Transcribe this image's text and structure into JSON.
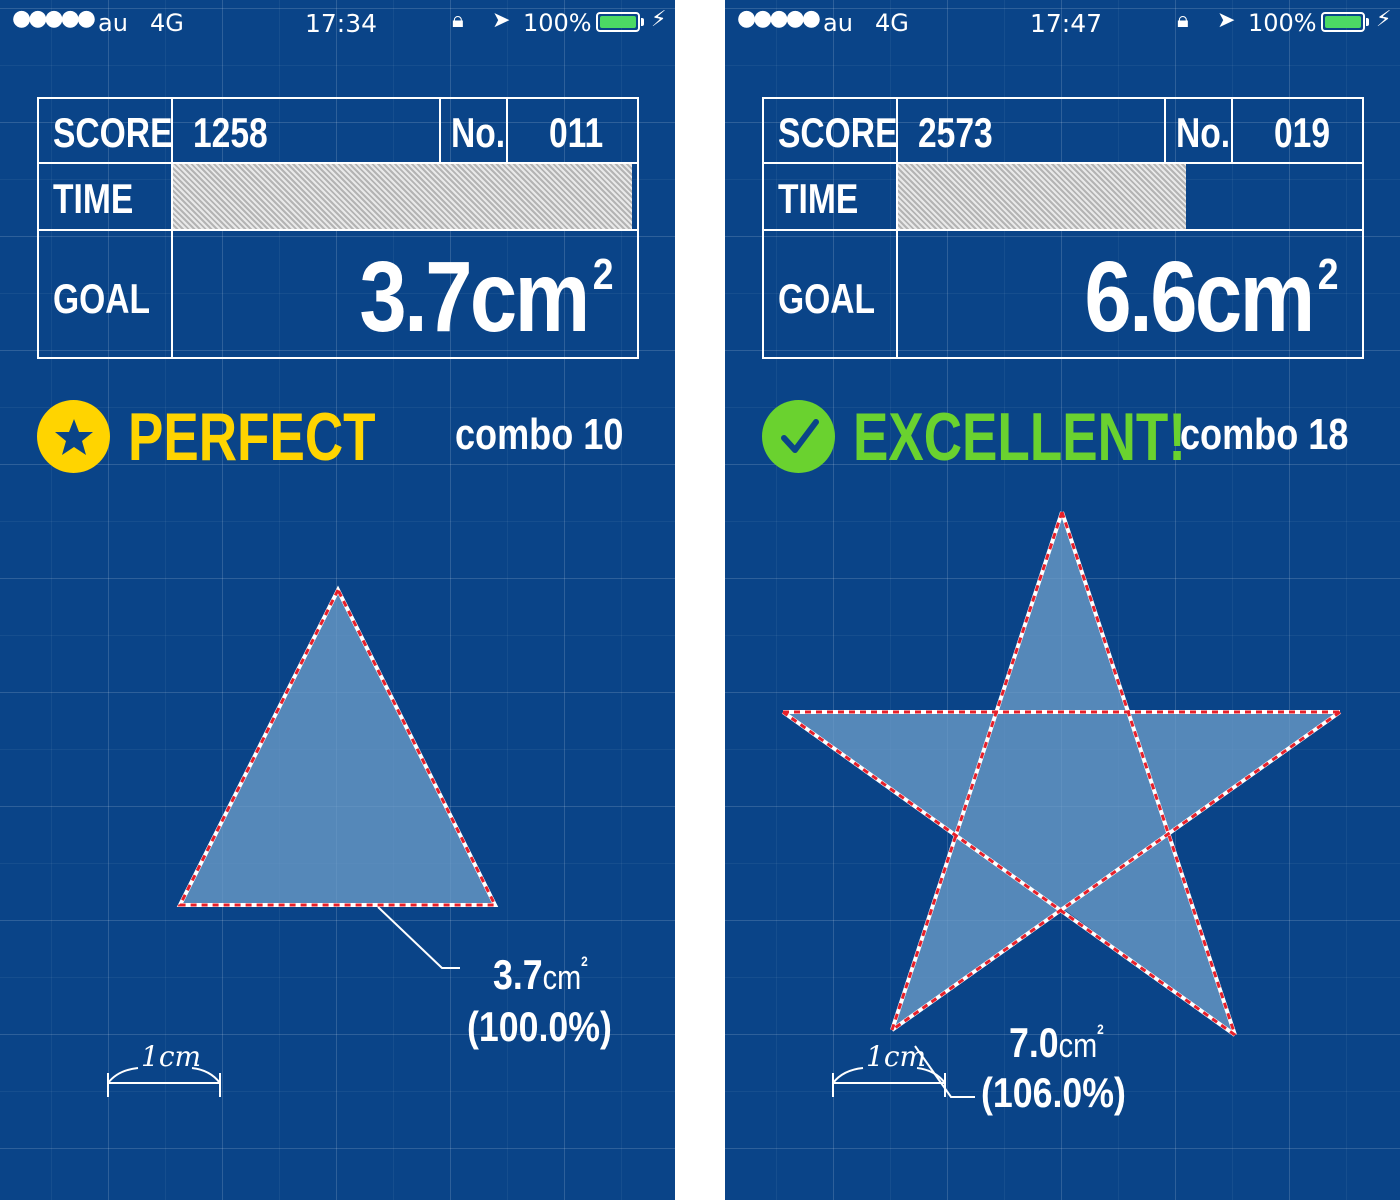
{
  "screens": [
    {
      "status": {
        "signal": "●●●●●",
        "carrier": "au",
        "network": "4G",
        "time": "17:34",
        "battery": "100%",
        "battery_level": 1.0
      },
      "board": {
        "score_label": "SCORE",
        "score": "1258",
        "no_label": "No.",
        "no": "011",
        "time_label": "TIME",
        "time_remaining": 0.99,
        "goal_label": "GOAL",
        "goal_value": "3.7cm",
        "goal_sup": "2"
      },
      "rating": {
        "text": "PERFECT",
        "color": "#ffd400",
        "icon": "star-icon",
        "combo": "combo 10"
      },
      "shape": {
        "type": "triangle",
        "area": "3.7",
        "unit": "cm",
        "unit_sup": "2",
        "percent": "(100.0%)"
      },
      "scale_label": "1cm"
    },
    {
      "status": {
        "signal": "●●●●●",
        "carrier": "au",
        "network": "4G",
        "time": "17:47",
        "battery": "100%",
        "battery_level": 1.0
      },
      "board": {
        "score_label": "SCORE",
        "score": "2573",
        "no_label": "No.",
        "no": "019",
        "time_label": "TIME",
        "time_remaining": 0.62,
        "goal_label": "GOAL",
        "goal_value": "6.6cm",
        "goal_sup": "2"
      },
      "rating": {
        "text": "EXCELLENT!",
        "color": "#6ad22f",
        "icon": "checkmark-icon",
        "combo": "combo 18"
      },
      "shape": {
        "type": "star",
        "area": "7.0",
        "unit": "cm",
        "unit_sup": "2",
        "percent": "(106.0%)"
      },
      "scale_label": "1cm"
    }
  ],
  "colors": {
    "background": "#0a4488",
    "dash": "#e8202a",
    "shape_fill": "#6f9fc9"
  }
}
